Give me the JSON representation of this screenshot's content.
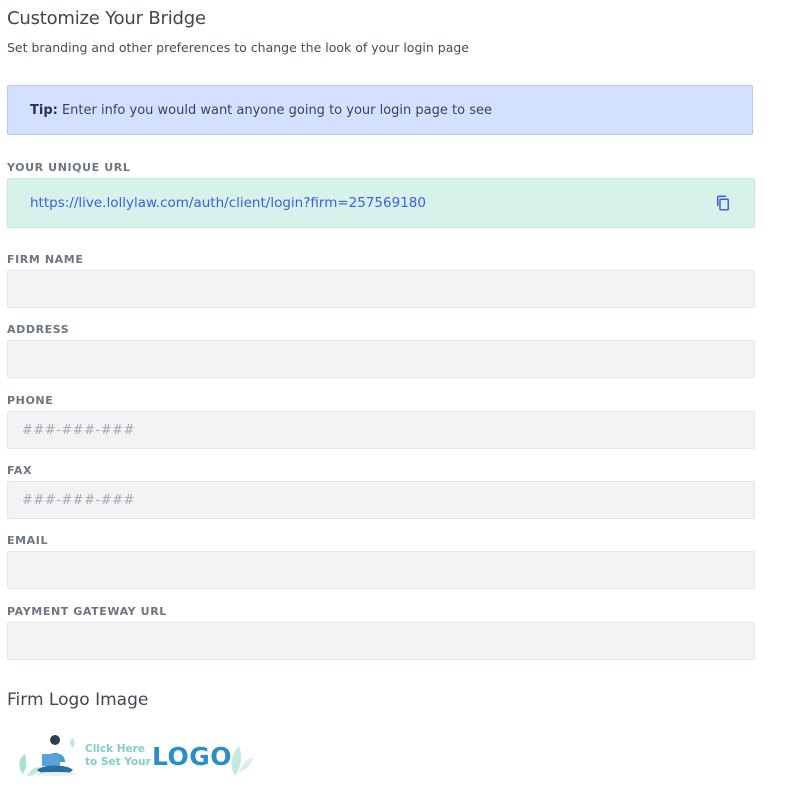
{
  "header": {
    "title": "Customize Your Bridge",
    "subtitle": "Set branding and other preferences to change the look of your login page"
  },
  "tip": {
    "label": "Tip:",
    "text": " Enter info you would want anyone going to your login page to see"
  },
  "unique_url": {
    "label": "YOUR UNIQUE URL",
    "value": "https://live.lollylaw.com/auth/client/login?firm=257569180",
    "copy_icon": "copy-icon"
  },
  "fields": {
    "firm_name": {
      "label": "FIRM NAME",
      "value": "",
      "placeholder": ""
    },
    "address": {
      "label": "ADDRESS",
      "value": "",
      "placeholder": ""
    },
    "phone": {
      "label": "PHONE",
      "value": "",
      "placeholder": "###-###-###"
    },
    "fax": {
      "label": "FAX",
      "value": "",
      "placeholder": "###-###-###"
    },
    "email": {
      "label": "EMAIL",
      "value": "",
      "placeholder": ""
    },
    "payment_gateway_url": {
      "label": "PAYMENT GATEWAY URL",
      "value": "",
      "placeholder": ""
    }
  },
  "logo": {
    "title": "Firm Logo Image",
    "cta_line1": "Click Here",
    "cta_line2": "to Set Your",
    "word": "LOGO"
  },
  "colors": {
    "tip_bg": "#d4e0ff",
    "url_bg": "#d6f2ea",
    "link": "#3b5fe0",
    "input_bg": "#f2f3f5",
    "logo_blue": "#2a8fc9",
    "logo_mint": "#7fd0c0"
  }
}
